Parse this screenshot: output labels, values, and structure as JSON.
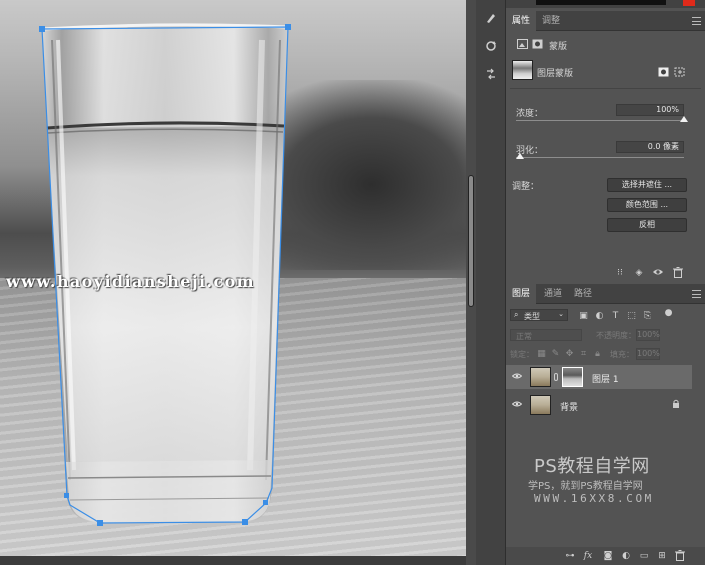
{
  "canvas": {
    "watermark": "www.haoyidiansheji.com"
  },
  "toolstrip": {
    "tools": [
      "history-brush-tool-icon",
      "rotate-tool-icon",
      "swap-tool-icon"
    ]
  },
  "properties_panel": {
    "tabs": [
      {
        "label": "属性",
        "active": true
      },
      {
        "label": "调整",
        "active": false
      }
    ],
    "section_label": "蒙版",
    "layer_mask_label": "图层蒙版",
    "density_label": "浓度：",
    "density_value": "100%",
    "density_level": 1.0,
    "feather_label": "羽化：",
    "feather_value": "0.0 像素",
    "feather_level": 0.0,
    "adjust_label": "调整：",
    "buttons": {
      "select_and_mask": "选择并遮住 ...",
      "color_range": "颜色范围 ...",
      "invert": "反相"
    }
  },
  "layers_panel": {
    "tabs": [
      {
        "label": "图层",
        "active": true
      },
      {
        "label": "通道",
        "active": false
      },
      {
        "label": "路径",
        "active": false
      }
    ],
    "filter_kind": "类型",
    "blend_mode": "正常",
    "opacity_label": "不透明度：",
    "opacity_value": "100%",
    "lock_label": "锁定：",
    "fill_label": "填充：",
    "fill_value": "100%",
    "layers": [
      {
        "name": "图层 1",
        "selected": true,
        "has_mask": true
      },
      {
        "name": "背景",
        "selected": false,
        "locked": true
      }
    ]
  },
  "brand": {
    "title": "PS教程自学网",
    "subtitle": "学PS，就到PS教程自学网",
    "url": "WWW.16XX8.COM"
  },
  "colors": {
    "panel_bg": "#535353",
    "tabbar_bg": "#424242",
    "selection_blue": "#3b8ee6",
    "accent_red": "#e02a1a"
  }
}
